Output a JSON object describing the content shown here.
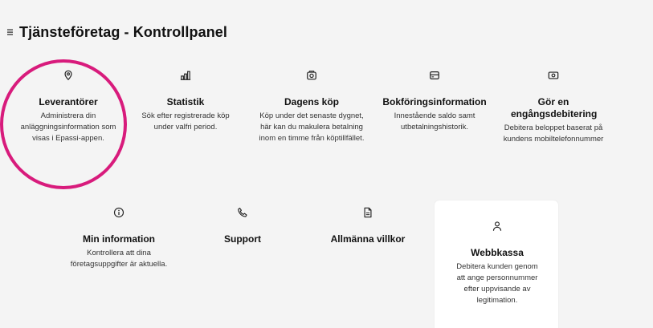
{
  "header": {
    "title": "Tjänsteföretag - Kontrollpanel"
  },
  "colors": {
    "highlight": "#d81b7c",
    "background": "#f4f4f4",
    "card_bg": "#ffffff"
  },
  "cards": [
    {
      "icon": "location-pin-icon",
      "label": "Leverantörer",
      "desc": "Administrera din anläggningsinformation som visas i Epassi-appen."
    },
    {
      "icon": "bar-chart-icon",
      "label": "Statistik",
      "desc": "Sök efter registrerade köp under valfri period."
    },
    {
      "icon": "cash-register-icon",
      "label": "Dagens köp",
      "desc": "Köp under det senaste dygnet, här kan du makulera betalning inom en timme från köptillfället."
    },
    {
      "icon": "wallet-card-icon",
      "label": "Bokföringsinformation",
      "desc": "Innestående saldo samt utbetalningshistorik."
    },
    {
      "icon": "cash-icon",
      "label": "Gör en engångsdebitering",
      "desc": "Debitera beloppet baserat på kundens mobiltelefonnummer"
    },
    {
      "icon": "info-icon",
      "label": "Min information",
      "desc": "Kontrollera att dina företagsuppgifter är aktuella."
    },
    {
      "icon": "phone-icon",
      "label": "Support",
      "desc": ""
    },
    {
      "icon": "document-icon",
      "label": "Allmänna villkor",
      "desc": ""
    },
    {
      "icon": "person-icon",
      "label": "Webbkassa",
      "desc": "Debitera kunden genom att ange personnummer efter uppvisande av legitimation."
    }
  ]
}
